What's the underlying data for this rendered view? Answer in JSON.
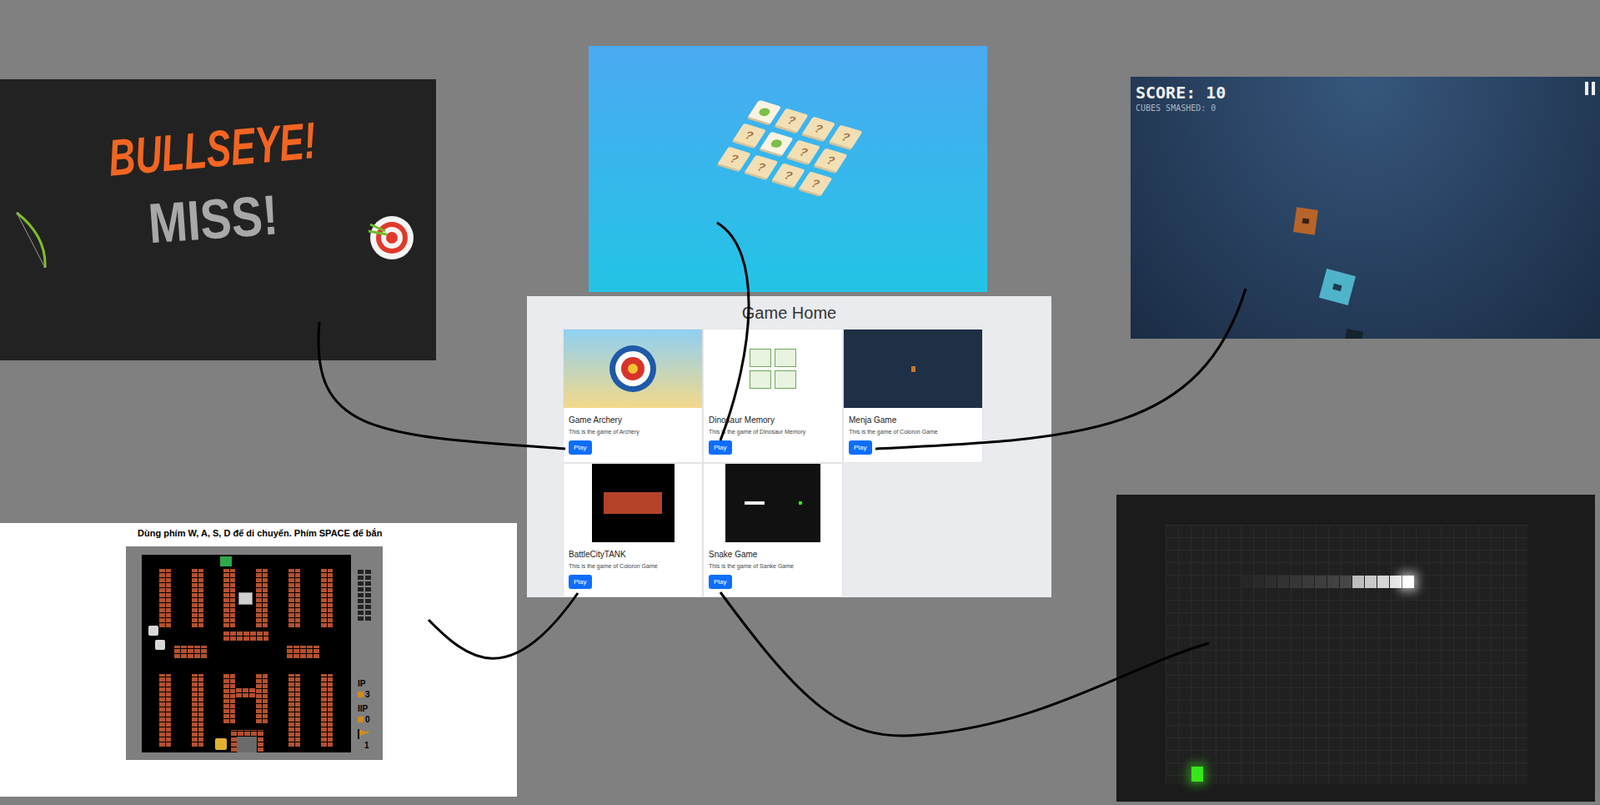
{
  "home": {
    "title": "Game Home",
    "games": [
      {
        "title": "Game Archery",
        "description": "This is the game of Archery",
        "button": "Play"
      },
      {
        "title": "Dinosaur Memory",
        "description": "This is the game of Dinosaur Memory",
        "button": "Play"
      },
      {
        "title": "Menja Game",
        "description": "This is the game of Coloron Game",
        "button": "Play"
      },
      {
        "title": "BattleCityTANK",
        "description": "This is the game of Coloron Game",
        "button": "Play"
      },
      {
        "title": "Snake Game",
        "description": "This is the game of Sanke Game",
        "button": "Play"
      }
    ]
  },
  "archery_screen": {
    "headline": "BULLSEYE!",
    "result": "MISS!"
  },
  "memory_screen": {
    "cards": [
      {
        "flipped": true
      },
      {
        "flipped": false,
        "label": "?"
      },
      {
        "flipped": false,
        "label": "?"
      },
      {
        "flipped": false,
        "label": "?"
      },
      {
        "flipped": false,
        "label": "?"
      },
      {
        "flipped": true
      },
      {
        "flipped": false,
        "label": "?"
      },
      {
        "flipped": false,
        "label": "?"
      },
      {
        "flipped": false,
        "label": "?"
      },
      {
        "flipped": false,
        "label": "?"
      },
      {
        "flipped": false,
        "label": "?"
      },
      {
        "flipped": false,
        "label": "?"
      }
    ]
  },
  "cube_screen": {
    "score": "SCORE: 10",
    "smashed": "CUBES SMASHED: 0"
  },
  "tank_screen": {
    "instructions": "Dùng phím W, A, S, D để di chuyển. Phím SPACE để bắn",
    "p1_label": "IP",
    "p1_lives": "3",
    "p2_label": "IIP",
    "p2_lives": "0",
    "stage": "1"
  }
}
